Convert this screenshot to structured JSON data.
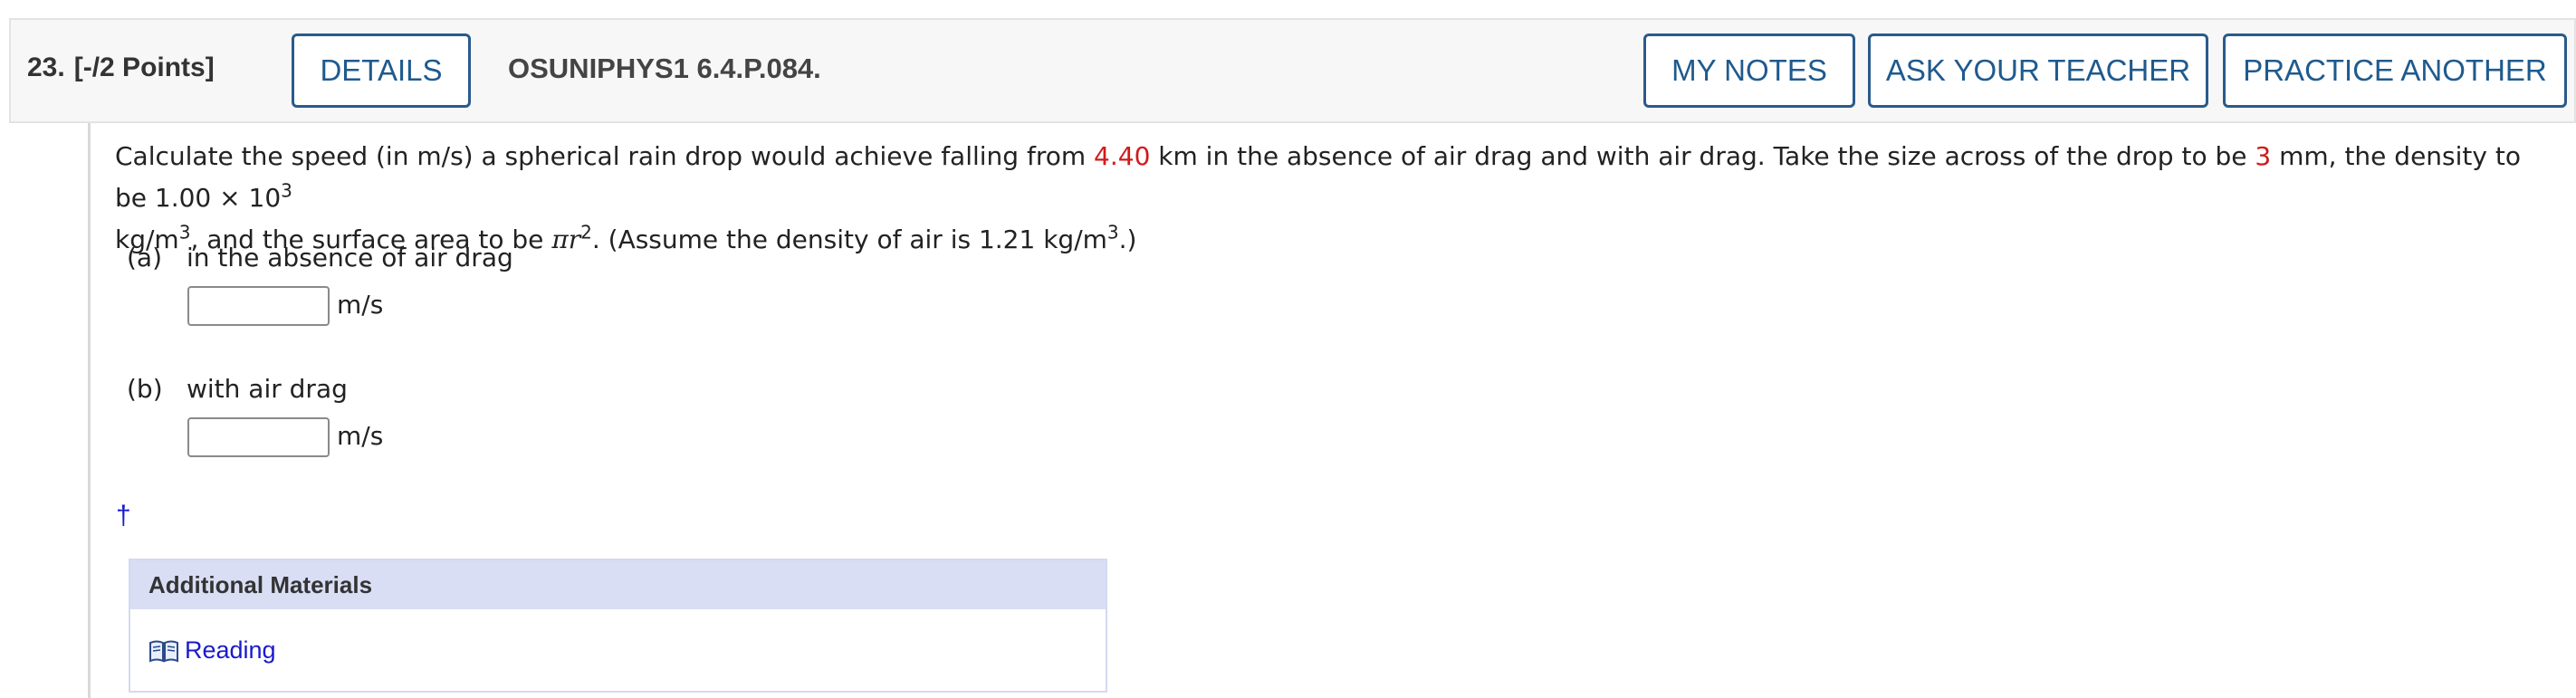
{
  "header": {
    "question_number": "23.",
    "points": "[-/2 Points]",
    "details_label": "DETAILS",
    "question_code": "OSUNIPHYS1 6.4.P.084.",
    "my_notes_label": "MY NOTES",
    "ask_teacher_label": "ASK YOUR TEACHER",
    "practice_another_label": "PRACTICE ANOTHER"
  },
  "problem": {
    "t1": "Calculate the speed (in m/s) a spherical rain drop would achieve falling from ",
    "height_value": "4.40",
    "t2": " km in the absence of air drag and with air drag. Take the size across of the drop to be ",
    "size_value": "3",
    "t3": " mm, the density to be 1.00 × 10",
    "t3_sup": "3",
    "t4": "kg/m",
    "t4_sup": "3",
    "t5": ", and the surface area to be ",
    "pi_r": "πr",
    "t5_sup": "2",
    "t6": ". (Assume the density of air is 1.21 kg/m",
    "t6_sup": "3",
    "t7": ".)"
  },
  "parts": [
    {
      "letter": "(a)",
      "label": "in the absence of air drag",
      "value": "",
      "unit": "m/s"
    },
    {
      "letter": "(b)",
      "label": "with air drag",
      "value": "",
      "unit": "m/s"
    }
  ],
  "dagger": "†",
  "materials": {
    "header": "Additional Materials",
    "reading_label": "Reading",
    "reading_icon": "book-icon"
  },
  "colors": {
    "button_border": "#2a5a8c",
    "highlight_red": "#d11a1a",
    "link_blue": "#1a1acc",
    "materials_header_bg": "#d9def5"
  }
}
